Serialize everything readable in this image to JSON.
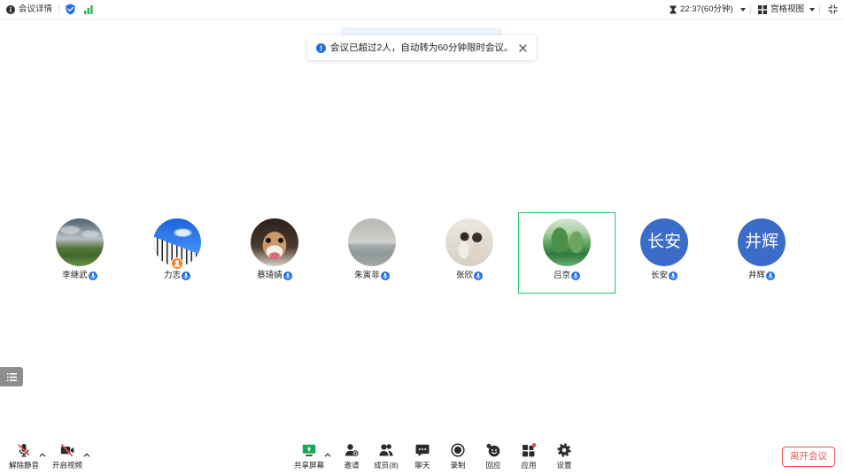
{
  "topbar": {
    "meeting_info_label": "会议详情",
    "timer": "22:37(60分钟)",
    "view_mode_label": "宫格视图"
  },
  "toast": {
    "message": "会议已超过2人，自动转为60分钟限时会议。"
  },
  "participants": [
    {
      "name": "李继武"
    },
    {
      "name": "力志",
      "host": true
    },
    {
      "name": "蔡琦婧"
    },
    {
      "name": "朱寅非"
    },
    {
      "name": "张欣"
    },
    {
      "name": "吕京",
      "speaking": true
    },
    {
      "name": "长安",
      "avatar_text": "长安"
    },
    {
      "name": "井辉",
      "avatar_text": "井辉"
    }
  ],
  "toolbar": {
    "unmute_label": "解除静音",
    "start_video_label": "开启视频",
    "share_screen_label": "共享屏幕",
    "invite_label": "邀请",
    "members_label": "成员(8)",
    "chat_label": "聊天",
    "record_label": "录制",
    "react_label": "回应",
    "apps_label": "应用",
    "settings_label": "设置",
    "leave_label": "离开会议"
  },
  "icons": {
    "meeting_info": "info-icon",
    "security": "shield-icon",
    "network": "signal-icon",
    "timer": "hourglass-icon",
    "view_mode": "grid-icon",
    "exit_fullscreen": "exit-fullscreen-icon",
    "toast": "info-icon",
    "toast_close": "close-icon",
    "side_panel": "list-icon",
    "participant_mic": "mic-icon",
    "host_badge": "host-icon",
    "unmute": "mic-off-icon",
    "start_video": "video-off-icon",
    "share_screen": "share-screen-icon",
    "invite": "invite-icon",
    "members": "members-icon",
    "chat": "chat-icon",
    "record": "record-icon",
    "react": "react-icon",
    "apps": "apps-icon",
    "settings": "settings-icon",
    "menu_caret": "chevron-up-icon"
  },
  "colors": {
    "accent_blue": "#1f6fea",
    "avatar_blue": "#3b6cc7",
    "speaking_green": "#2cbf6b",
    "danger_red": "#e9574f",
    "share_green": "#19a952",
    "host_orange": "#f5852b",
    "signal_green": "#2ab24b"
  }
}
